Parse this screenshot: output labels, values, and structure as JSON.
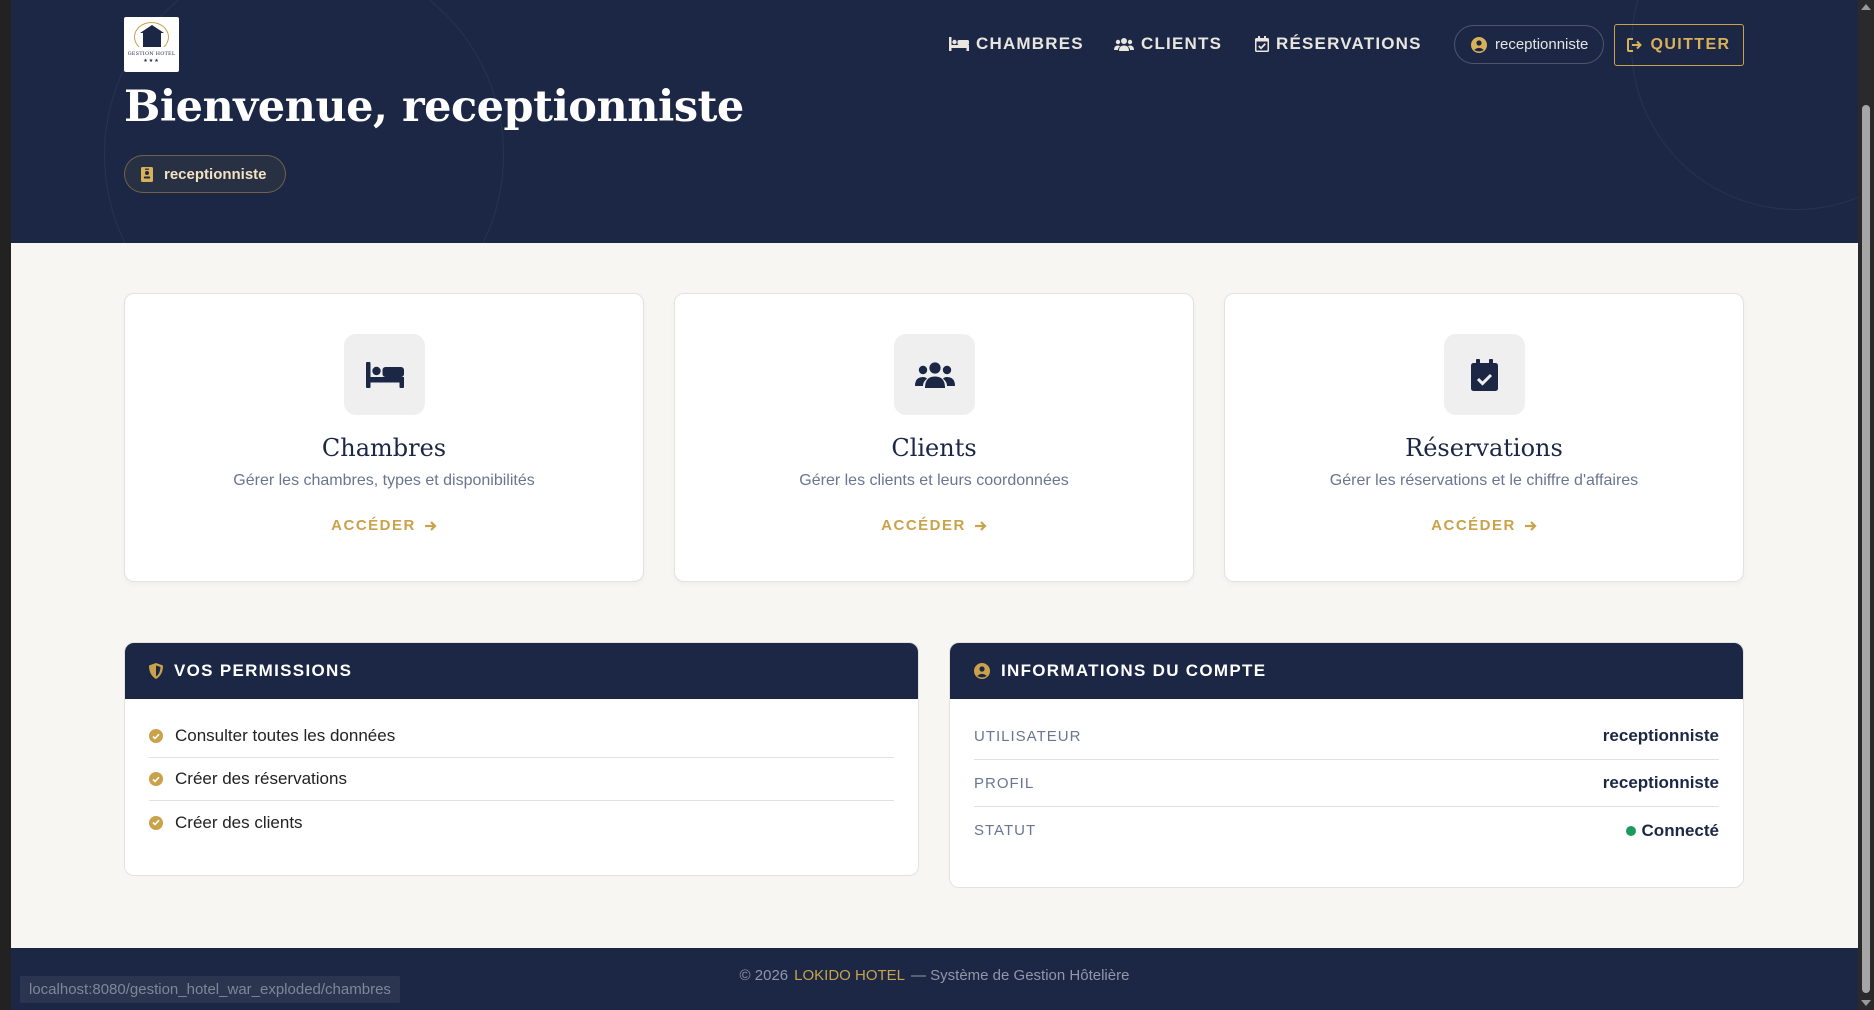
{
  "nav": {
    "chambres": "CHAMBRES",
    "clients": "CLIENTS",
    "reservations": "RÉSERVATIONS"
  },
  "user": {
    "username": "receptionniste",
    "quit_label": "QUITTER"
  },
  "logo": {
    "text": "GESTION HOTEL",
    "stars": "★★★"
  },
  "hero": {
    "welcome": "Bienvenue, receptionniste",
    "role_badge": "receptionniste"
  },
  "cards": [
    {
      "title": "Chambres",
      "description": "Gérer les chambres, types et disponibilités",
      "cta": "ACCÉDER",
      "icon": "bed-icon"
    },
    {
      "title": "Clients",
      "description": "Gérer les clients et leurs coordonnées",
      "cta": "ACCÉDER",
      "icon": "users-icon"
    },
    {
      "title": "Réservations",
      "description": "Gérer les réservations et le chiffre d'affaires",
      "cta": "ACCÉDER",
      "icon": "calendar-check-icon"
    }
  ],
  "permissions": {
    "title": "VOS PERMISSIONS",
    "items": [
      "Consulter toutes les données",
      "Créer des réservations",
      "Créer des clients"
    ]
  },
  "account": {
    "title": "INFORMATIONS DU COMPTE",
    "rows": [
      {
        "key": "UTILISATEUR",
        "value": "receptionniste"
      },
      {
        "key": "PROFIL",
        "value": "receptionniste"
      },
      {
        "key": "STATUT",
        "value": "Connecté"
      }
    ]
  },
  "footer": {
    "copyright": "© 2026",
    "brand": "LOKIDO HOTEL",
    "tagline": "— Système de Gestion Hôtelière"
  },
  "status_bar": {
    "url": "localhost:8080/gestion_hotel_war_exploded/chambres"
  },
  "colors": {
    "navy": "#1b2744",
    "gold": "#c9a24a",
    "background": "#f7f6f2",
    "status_green": "#1a9a5c"
  }
}
